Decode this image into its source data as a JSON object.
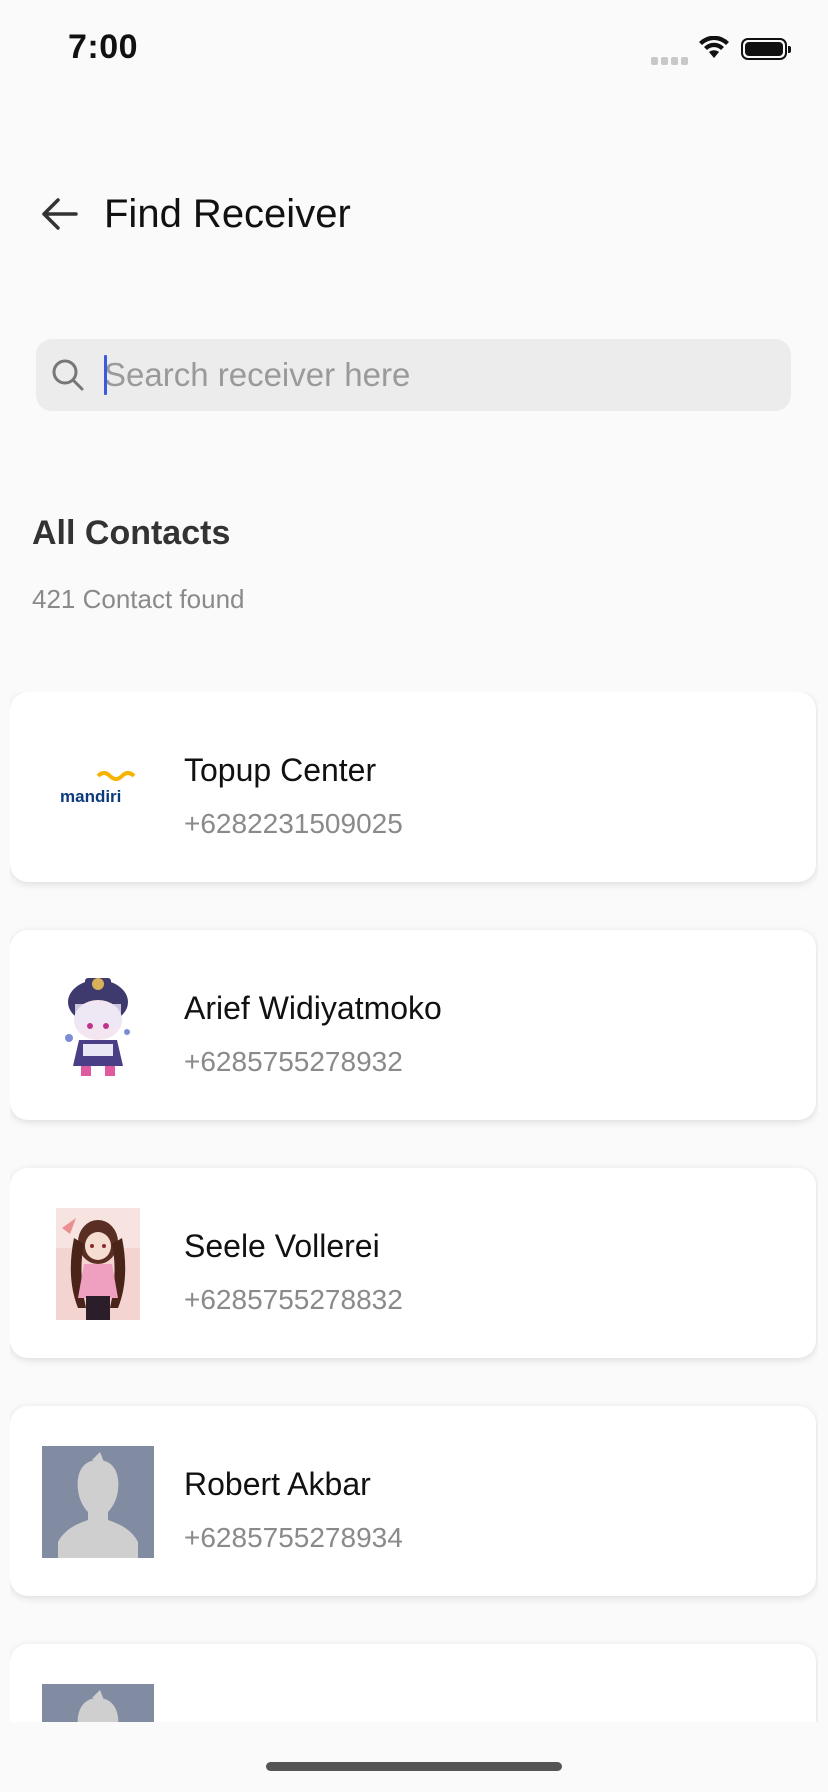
{
  "status_bar": {
    "time": "7:00"
  },
  "header": {
    "title": "Find Receiver",
    "back_icon": "arrow-left-icon"
  },
  "search": {
    "placeholder": "Search receiver here",
    "value": ""
  },
  "section": {
    "title": "All Contacts",
    "subtitle": "421 Contact found"
  },
  "contacts": [
    {
      "name": "Topup Center",
      "phone": "+6282231509025",
      "avatar": "mandiri-logo",
      "logo_text": "mandiri"
    },
    {
      "name": "Arief Widiyatmoko",
      "phone": "+6285755278932",
      "avatar": "anime-chibi-avatar"
    },
    {
      "name": "Seele Vollerei",
      "phone": "+6285755278832",
      "avatar": "anime-girl-avatar"
    },
    {
      "name": "Robert Akbar",
      "phone": "+6285755278934",
      "avatar": "default-person-avatar"
    },
    {
      "name": "",
      "phone": "",
      "avatar": "default-person-avatar"
    }
  ],
  "colors": {
    "accent": "#3b5bdb",
    "card_bg": "#ffffff",
    "search_bg": "#ececec",
    "muted_text": "#8a8a8a"
  }
}
